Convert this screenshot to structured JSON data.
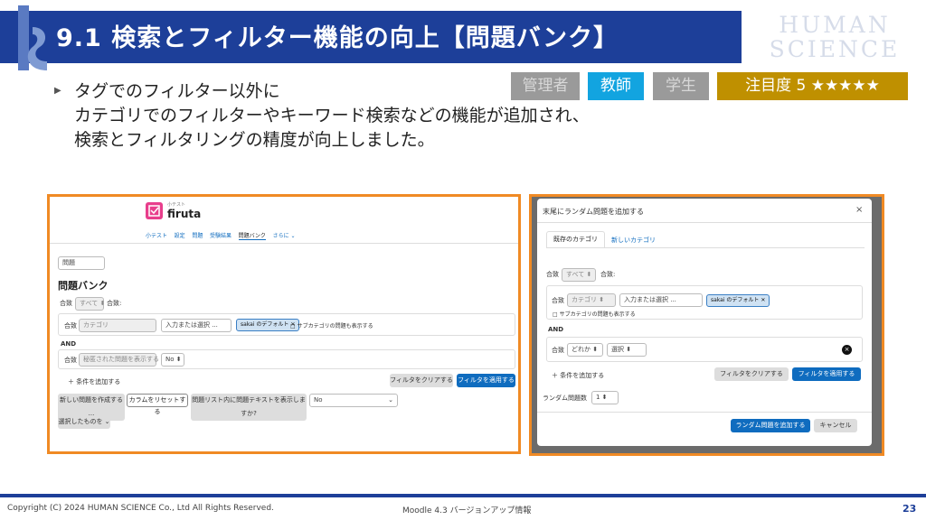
{
  "header": {
    "title": "9.1 検索とフィルター機能の向上【問題バンク】",
    "brand_line1": "HUMAN",
    "brand_line2": "SCIENCE"
  },
  "badges": {
    "admin": "管理者",
    "teacher": "教師",
    "student": "学生",
    "attention": "注目度 5 ★★★★★"
  },
  "description": {
    "bullet": "▶",
    "line1": "タグでのフィルター以外に",
    "line2": "カテゴリでのフィルターやキーワード検索などの機能が追加され、",
    "line3": "検索とフィルタリングの精度が向上しました。"
  },
  "left_shot": {
    "site_small": "小テスト",
    "site_name": "firuta",
    "nav": [
      "小テスト",
      "設定",
      "問題",
      "受験結果",
      "問題バンク",
      "さらに ⌄"
    ],
    "dropdown": "問題",
    "page_title": "問題バンク",
    "match_label1": "合致",
    "match_value1": "すべて ⬍",
    "match_label1b": "合致:",
    "row1_label": "合致",
    "row1_category": "カテゴリ",
    "row1_input": "入力または選択 ...",
    "row1_chip": "sakai のデフォルト ✕",
    "row1_checkbox": "□ サブカテゴリの問題も表示する",
    "and_label": "AND",
    "row2_label": "合致",
    "row2_select": "秘匿された問題を表示する",
    "row2_value": "No ⬍",
    "add_condition": "＋  条件を追加する",
    "clear_button": "フィルタをクリアする",
    "apply_button": "フィルタを適用する",
    "new_question": "新しい問題を作成する ...",
    "reset_columns": "カラムをリセットする",
    "show_text": "問題リスト内に問題テキストを表示しますか?",
    "show_text_value": "No",
    "with_selected": "選択したものを ⌄"
  },
  "right_shot": {
    "dialog_title": "末尾にランダム問題を追加する",
    "close": "×",
    "tab_existing": "既存のカテゴリ",
    "tab_new": "新しいカテゴリ",
    "match_label": "合致",
    "match_value": "すべて ⬍",
    "match_label_b": "合致:",
    "row1_label": "合致",
    "row1_category": "カテゴリ ⬍",
    "row1_input": "入力または選択 ...",
    "row1_chip": "sakai のデフォルト ✕",
    "row1_checkbox": "□ サブカテゴリの問題も表示する",
    "and_label": "AND",
    "row2_label": "合致",
    "row2_any": "どれか ⬍",
    "row2_select": "選択 ⬍",
    "add_condition": "＋  条件を追加する",
    "clear_button": "フィルタをクリアする",
    "apply_button": "フィルタを適用する",
    "random_count_label": "ランダム問題数",
    "random_count_value": "1 ⬍",
    "add_random_button": "ランダム問題を追加する",
    "cancel_button": "キャンセル"
  },
  "footer": {
    "copyright": "Copyright (C) 2024 HUMAN SCIENCE Co., Ltd All Rights Reserved.",
    "middle": "Moodle 4.3 バージョンアップ情報",
    "page": "23"
  },
  "colors": {
    "header_blue": "#1d3f99",
    "teacher_badge": "#12a4e0",
    "attention_badge": "#bf9000",
    "frame_orange": "#f08a24",
    "moodle_blue": "#0f6cbf"
  }
}
